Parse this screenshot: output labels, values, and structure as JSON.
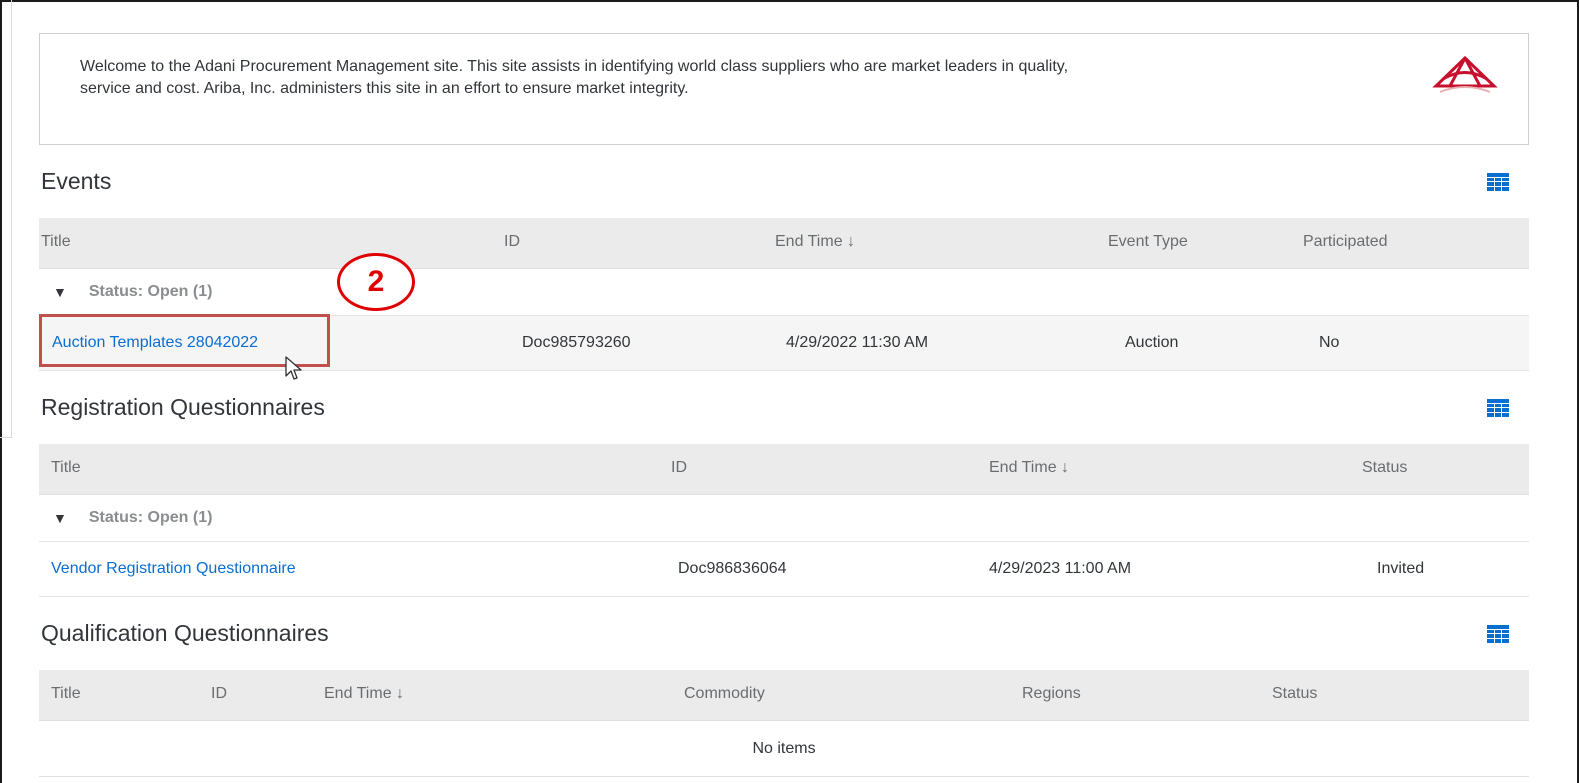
{
  "welcome": {
    "text_line1": "Welcome to the Adani Procurement  Management site. This site assists in identifying world class suppliers who are market leaders in quality,",
    "text_line2": "service and cost. Ariba, Inc. administers this site in an effort to ensure market integrity.",
    "logo_icon": "ariba-logo-icon"
  },
  "events": {
    "title": "Events",
    "columns": [
      "Title",
      "ID",
      "End Time ↓",
      "Event Type",
      "Participated"
    ],
    "group_label": "Status: Open  (1)",
    "rows": [
      {
        "title": "Auction Templates 28042022",
        "id": "Doc985793260",
        "end_time": "4/29/2022 11:30 AM",
        "event_type": "Auction",
        "participated": "No"
      }
    ]
  },
  "registration": {
    "title": "Registration Questionnaires",
    "columns": [
      "Title",
      "ID",
      "End Time ↓",
      "Status"
    ],
    "group_label": "Status: Open  (1)",
    "rows": [
      {
        "title": "Vendor Registration Questionnaire",
        "id": "Doc986836064",
        "end_time": "4/29/2023 11:00 AM",
        "status": "Invited"
      }
    ]
  },
  "qualification": {
    "title": "Qualification Questionnaires",
    "columns": [
      "Title",
      "ID",
      "End Time ↓",
      "Commodity",
      "Regions",
      "Status"
    ],
    "empty_text": "No items"
  },
  "annotation": {
    "callout_number": "2",
    "highlight_color": "#c0504d",
    "callout_color": "#e00000"
  },
  "colors": {
    "link": "#0a6ed1",
    "header_bg": "#ebebeb",
    "grid_icon": "#0a6ed1"
  }
}
